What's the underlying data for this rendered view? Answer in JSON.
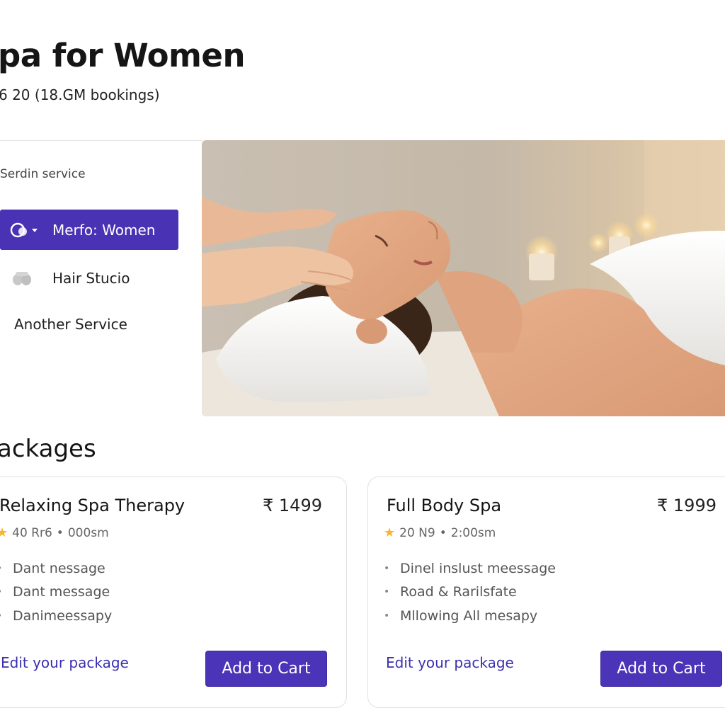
{
  "header": {
    "title": "pa for Women",
    "rating_line": "6 20 (18.GM bookings)"
  },
  "sidebar": {
    "heading": "Serdin service",
    "items": [
      {
        "label": "Merfo: Women",
        "icon": "spa-icon",
        "active": true
      },
      {
        "label": "Hair Stucio",
        "icon": "hair-icon",
        "active": false
      },
      {
        "label": "Another Service",
        "icon": "",
        "active": false
      }
    ]
  },
  "hero": {
    "subject": "spa-massage-photo"
  },
  "packages": {
    "title": "ackages",
    "cards": [
      {
        "name": "Relaxing Spa Therapy",
        "price": "₹ 1499",
        "rating": "40 Rr6",
        "duration": "000sm",
        "features": [
          "Dant nessage",
          "Dant message",
          "Danimeessapy"
        ],
        "edit_label": "Edit your package",
        "cart_label": "Add to Cart"
      },
      {
        "name": "Full Body Spa",
        "price": "₹ 1999",
        "rating": "20 N9",
        "duration": "2:00sm",
        "features": [
          "Dinel inslust meessage",
          "Road & Rarilsfate",
          "Mllowing All mesapy"
        ],
        "edit_label": "Edit your package",
        "cart_label": "Add to Cart"
      }
    ]
  },
  "colors": {
    "accent": "#4a32b4",
    "link": "#3a2fae",
    "star": "#f6b62b"
  }
}
